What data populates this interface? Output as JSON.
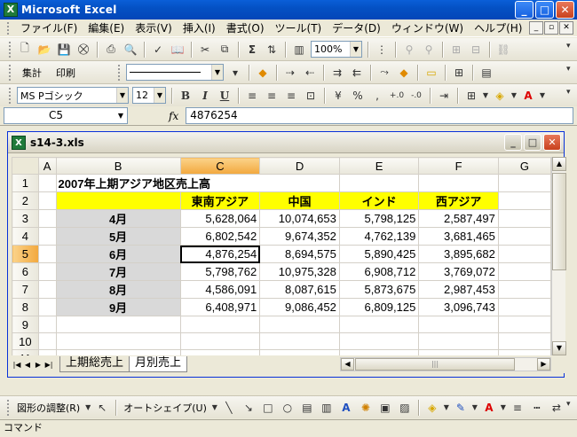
{
  "app": {
    "title": "Microsoft Excel",
    "icon": "excel-icon"
  },
  "menu": {
    "items": [
      "ファイル(F)",
      "編集(E)",
      "表示(V)",
      "挿入(I)",
      "書式(O)",
      "ツール(T)",
      "データ(D)",
      "ウィンドウ(W)",
      "ヘルプ(H)"
    ]
  },
  "toolbar1": {
    "sum_label": "Σ",
    "zoom": "100%"
  },
  "toolbar2": {
    "tally_label": "集計",
    "print_label": "印刷"
  },
  "toolbar3": {
    "font": "MS Pゴシック",
    "size": "12",
    "bold": "B",
    "italic": "I",
    "underline": "U",
    "percent": "%",
    "comma": ","
  },
  "formula_bar": {
    "name_box": "C5",
    "fx": "fx",
    "value": "4876254"
  },
  "workbook": {
    "filename": "s14-3.xls"
  },
  "sheet": {
    "columns": [
      "A",
      "B",
      "C",
      "D",
      "E",
      "F",
      "G"
    ],
    "title": "2007年上期アジア地区売上高",
    "headers": [
      "東南アジア",
      "中国",
      "インド",
      "西アジア"
    ],
    "rows": [
      {
        "month": "4月",
        "values": [
          "5,628,064",
          "10,074,653",
          "5,798,125",
          "2,587,497"
        ]
      },
      {
        "month": "5月",
        "values": [
          "6,802,542",
          "9,674,352",
          "4,762,139",
          "3,681,465"
        ]
      },
      {
        "month": "6月",
        "values": [
          "4,876,254",
          "8,694,575",
          "5,890,425",
          "3,895,682"
        ]
      },
      {
        "month": "7月",
        "values": [
          "5,798,762",
          "10,975,328",
          "6,908,712",
          "3,769,072"
        ]
      },
      {
        "month": "8月",
        "values": [
          "4,586,091",
          "8,087,615",
          "5,873,675",
          "2,987,453"
        ]
      },
      {
        "month": "9月",
        "values": [
          "6,408,971",
          "9,086,452",
          "6,809,125",
          "3,096,743"
        ]
      }
    ],
    "row_numbers": [
      "1",
      "2",
      "3",
      "4",
      "5",
      "6",
      "7",
      "8",
      "9",
      "10",
      "11"
    ]
  },
  "sheet_tabs": [
    "上期総売上",
    "月別売上"
  ],
  "drawbar": {
    "adjust_label": "図形の調整(R)",
    "autoshape_label": "オートシェイプ(U)"
  },
  "status": {
    "text": "コマンド"
  }
}
